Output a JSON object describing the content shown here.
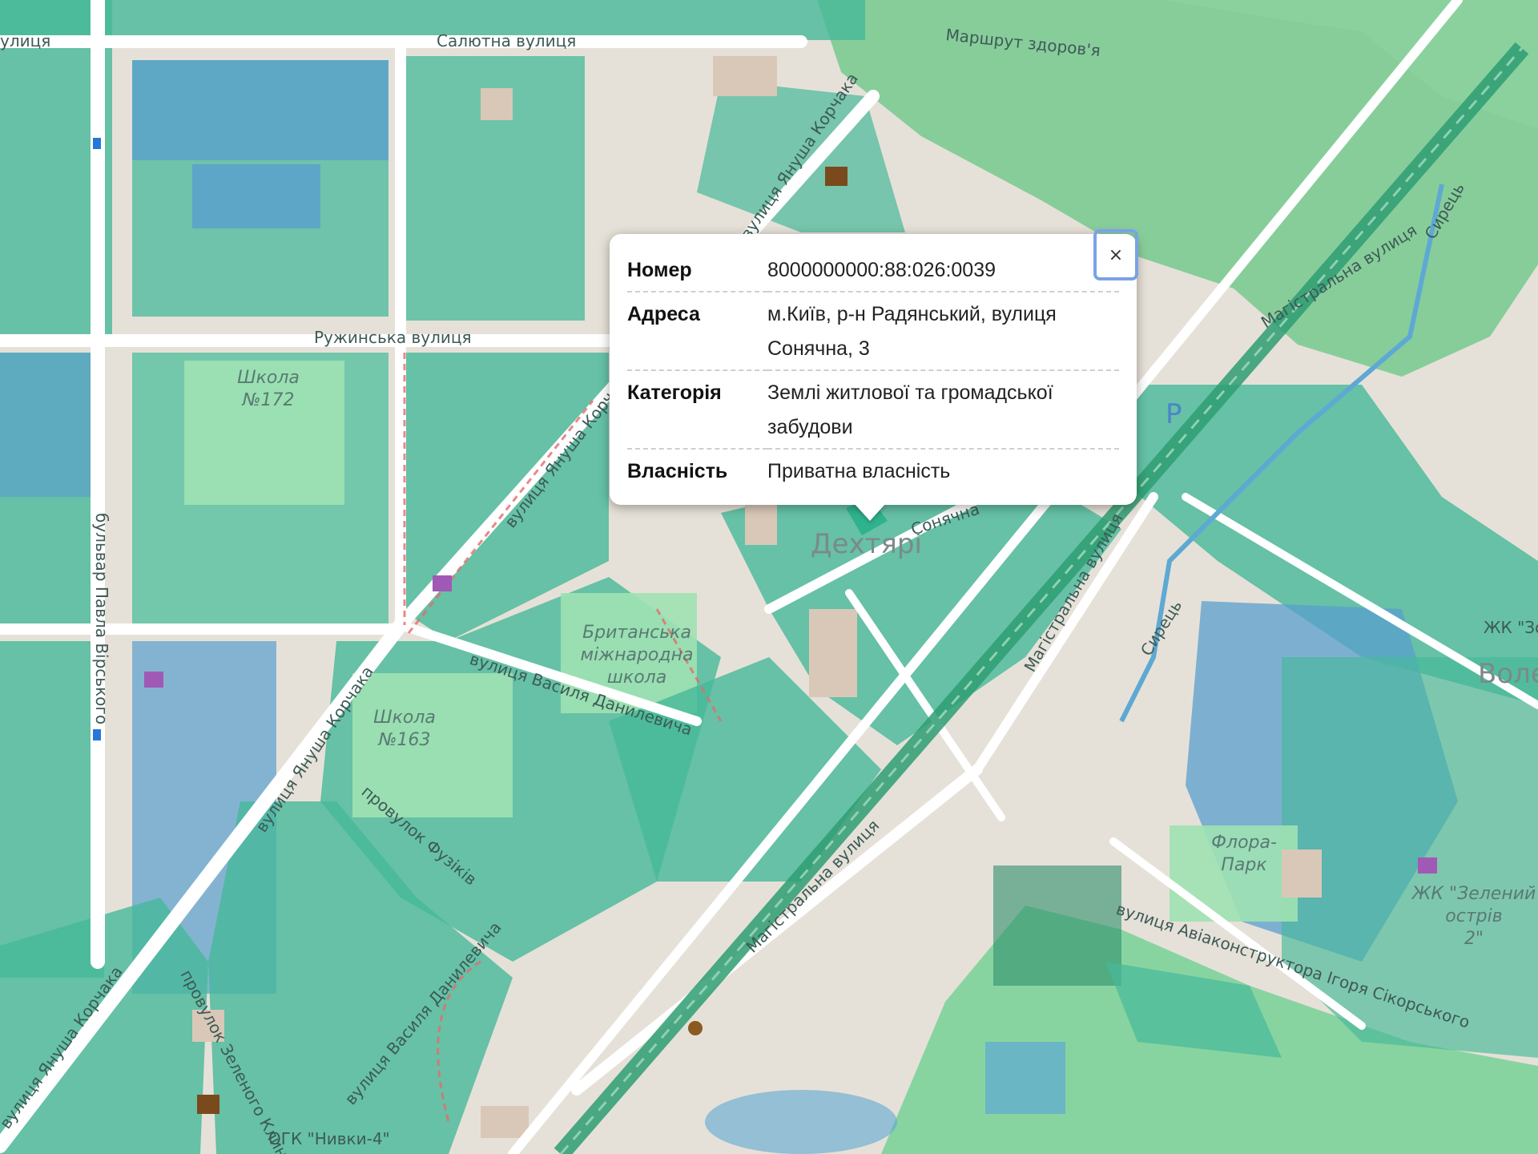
{
  "map": {
    "labels": {
      "salyutna": "Салютна вулиця",
      "ruzhynska": "Ружинська вулиця",
      "korchaka_top": "вулиця Януша Корчака",
      "korchaka_mid": "вулиця Януша Корча",
      "korchaka_low": "вулиця Януша Корчака",
      "korchaka_bottom": "вулиця Януша Корчака",
      "virskoho": "бульвар Павла Вірського",
      "ulytsia_left": "улиця",
      "school172_a": "Школа",
      "school172_b": "№172",
      "school163_a": "Школа",
      "school163_b": "№163",
      "british_a": "Британська",
      "british_b": "міжнародна",
      "british_c": "школа",
      "danylevycha_top": "вулиця Василя Данилевича",
      "danylevycha_bottom": "вулиця Василя Данилевича",
      "fuzikiv": "провулок Фузіків",
      "zelenoho": "провулок Зеленого Клину",
      "sonyachna": "Сонячна",
      "dehtiari": "Дехтярі",
      "mahistralna_right": "Магістральна вулиця",
      "mahistralna_mid": "Магістральна вулиця",
      "mahistralna_bottom": "Магістральна вулиця",
      "mahistralna_top": "Магістральна вулиця",
      "marshrut": "Маршрут здоров'я",
      "syrets_river": "Сирець",
      "syrets_top": "Сирець",
      "flora_a": "Флора-",
      "flora_b": "Парк",
      "zhk_zelenyi_a": "ЖК \"Зелений",
      "zhk_zelenyi_b": "острів",
      "zhk_zelenyi_c": "2\"",
      "zhk_right": "ЖК \"Зо",
      "vole": "Воле",
      "skorskoho": "вулиця Авіаконструктора Ігоря Сікорського",
      "ogk": "ОГК \"Нивки-4\"",
      "parking": "P"
    }
  },
  "popup": {
    "close_label": "×",
    "rows": [
      {
        "key": "Номер",
        "value": "8000000000:88:026:0039"
      },
      {
        "key": "Адреса",
        "value": "м.Київ, р-н Радянський, вулиця Сонячна, 3"
      },
      {
        "key": "Категорія",
        "value": "Землі житлової та громадської забудови"
      },
      {
        "key": "Власність",
        "value": "Приватна власність"
      }
    ]
  },
  "colors": {
    "parcel": "#3fbf9a",
    "building": "#d9c8b8",
    "road": "#ffffff",
    "park": "#b9e6b0",
    "forest": "#73c98e",
    "blue_zone": "#5d9fd0",
    "railway": "#2e9e73",
    "accent_close": "#7aa2e6"
  }
}
